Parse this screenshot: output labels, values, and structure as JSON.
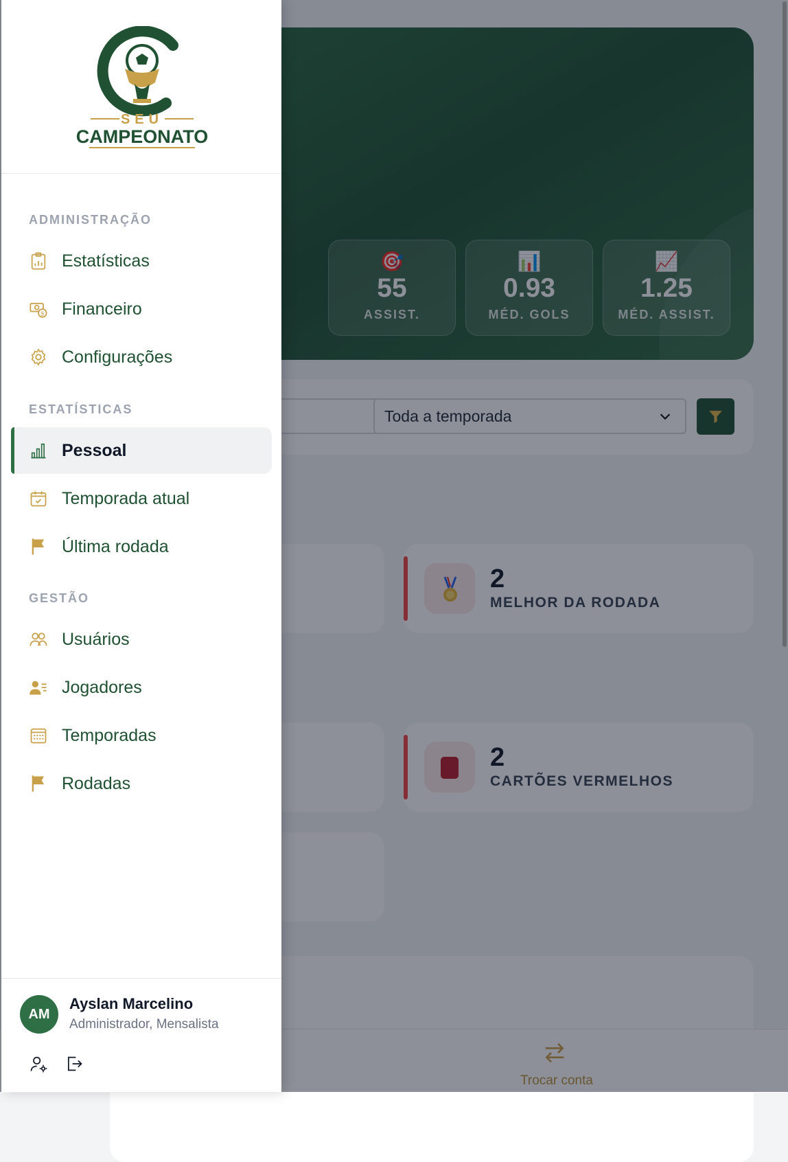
{
  "brand": {
    "logo_top": "SEU",
    "logo_bottom": "CAMPEONATO"
  },
  "colors": {
    "primary": "#1f5132",
    "accent": "#c9a04a",
    "danger": "#ef4444"
  },
  "hero": {
    "stats": [
      {
        "icon": "🎯",
        "value": "55",
        "label": "ASSIST."
      },
      {
        "icon": "📊",
        "value": "0.93",
        "label": "MÉD. GOLS"
      },
      {
        "icon": "📈",
        "value": "1.25",
        "label": "MÉD. ASSIST."
      }
    ]
  },
  "filters": {
    "season_select": "Toda a temporada"
  },
  "cards": {
    "best_of_round": {
      "value": "2",
      "label": "MELHOR DA RODADA"
    },
    "red_cards": {
      "value": "2",
      "label": "CARTÕES VERMELHOS"
    }
  },
  "bottom_nav": {
    "switch_account": "Trocar conta"
  },
  "sidebar": {
    "sections": {
      "admin": "ADMINISTRAÇÃO",
      "stats": "ESTATÍSTICAS",
      "management": "GESTÃO"
    },
    "items": {
      "estatisticas": "Estatísticas",
      "financeiro": "Financeiro",
      "configuracoes": "Configurações",
      "pessoal": "Pessoal",
      "temporada_atual": "Temporada atual",
      "ultima_rodada": "Última rodada",
      "usuarios": "Usuários",
      "jogadores": "Jogadores",
      "temporadas": "Temporadas",
      "rodadas": "Rodadas"
    },
    "active_item": "pessoal"
  },
  "user": {
    "initials": "AM",
    "name": "Ayslan Marcelino",
    "role": "Administrador, Mensalista"
  }
}
